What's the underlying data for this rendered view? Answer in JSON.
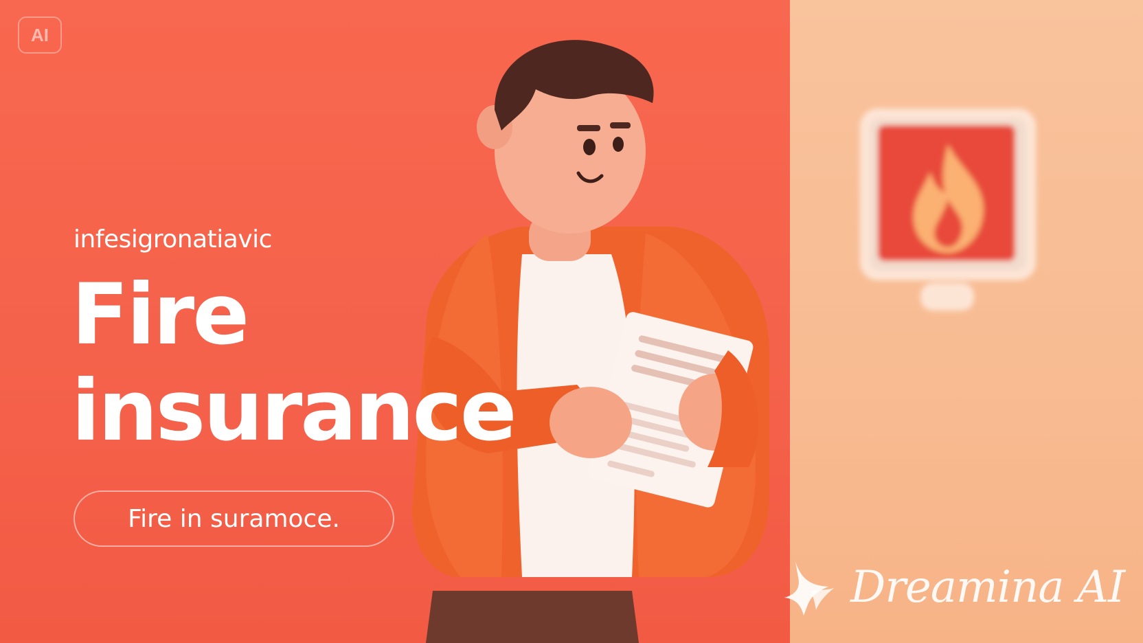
{
  "badge": {
    "label": "AI"
  },
  "hero": {
    "kicker": "infesigronatiavic",
    "headline_line1": "Fire",
    "headline_line2": "insurance",
    "pill_label": "Fire in suramoce."
  },
  "watermark": {
    "text": "Dreamina AI",
    "logo_icon": "dreamina-logo-icon"
  },
  "icons": {
    "alarm": "fire-alarm-icon",
    "person": "person-holding-document-illustration"
  },
  "colors": {
    "left_bg": "#f5624b",
    "right_bg": "#f8bb92",
    "jacket": "#f0622c",
    "alarm_red": "#e8473a",
    "text": "#ffffff"
  }
}
